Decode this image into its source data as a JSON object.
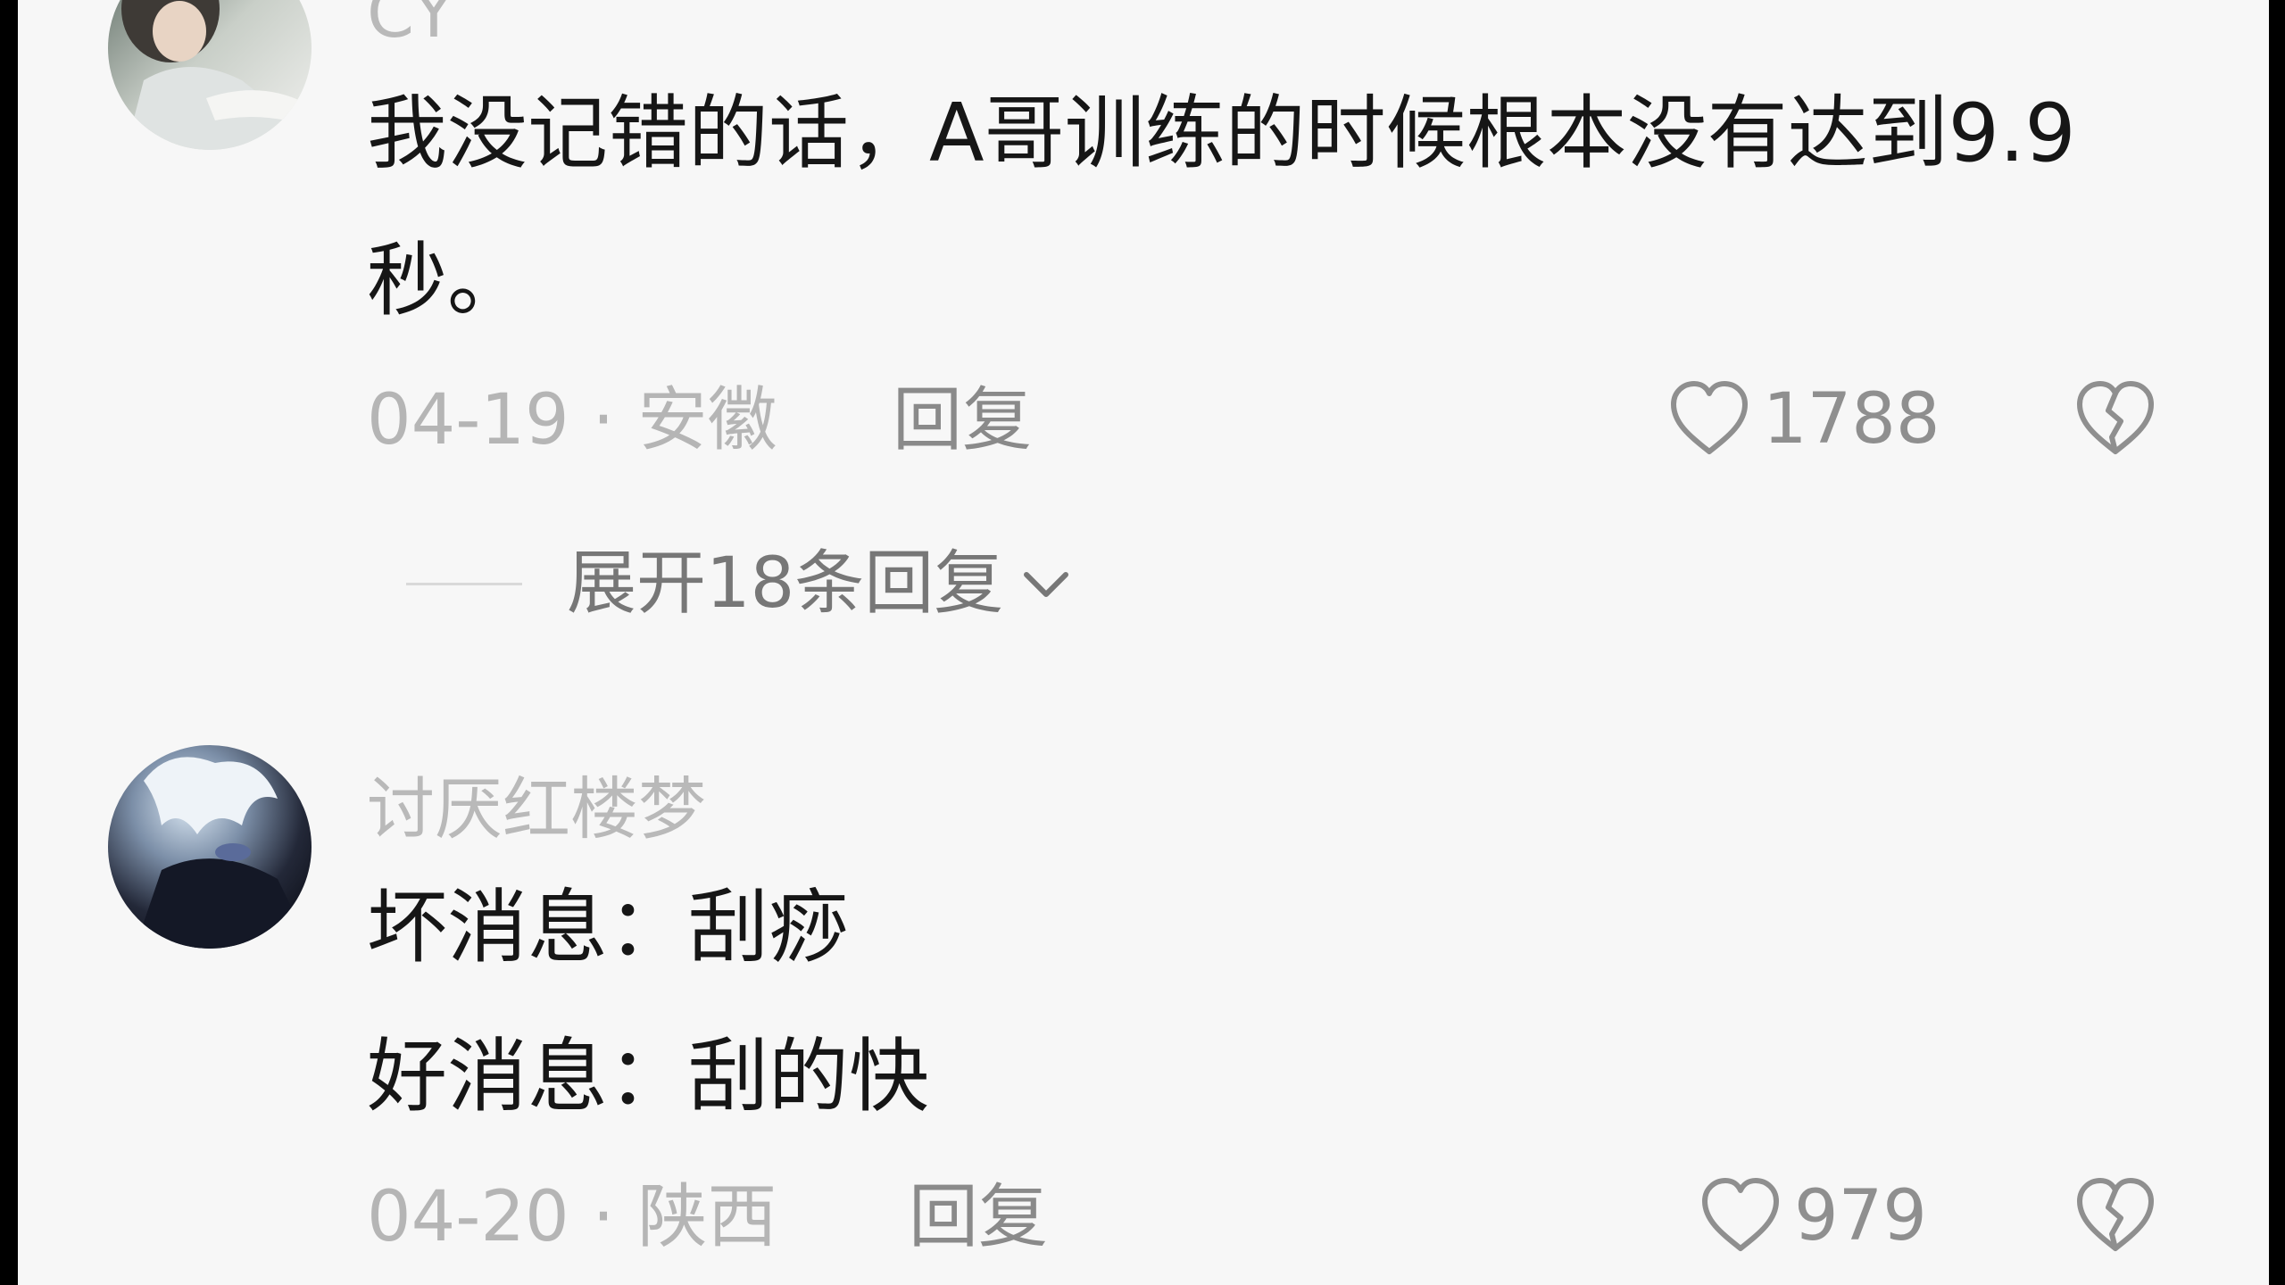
{
  "comments": [
    {
      "username": "CY",
      "lines": [
        "我没记错的话，A哥训练的时候根本没有达到9.9",
        "秒。"
      ],
      "date": "04-19",
      "separator": "·",
      "location": "安徽",
      "reply_label": "回复",
      "likes": "1788",
      "expand_label": "展开18条回复"
    },
    {
      "username": "讨厌红楼梦",
      "lines": [
        "坏消息：刮痧",
        "好消息：刮的快"
      ],
      "date": "04-20",
      "separator": "·",
      "location": "陕西",
      "reply_label": "回复",
      "likes": "979"
    }
  ],
  "icons": {
    "like": "heart-outline-icon",
    "dislike": "broken-heart-icon",
    "expand": "chevron-down-icon"
  },
  "colors": {
    "background": "#f7f7f7",
    "text_primary": "#161616",
    "text_secondary": "#b5b5b5",
    "icon_gray": "#8f8f8f"
  }
}
